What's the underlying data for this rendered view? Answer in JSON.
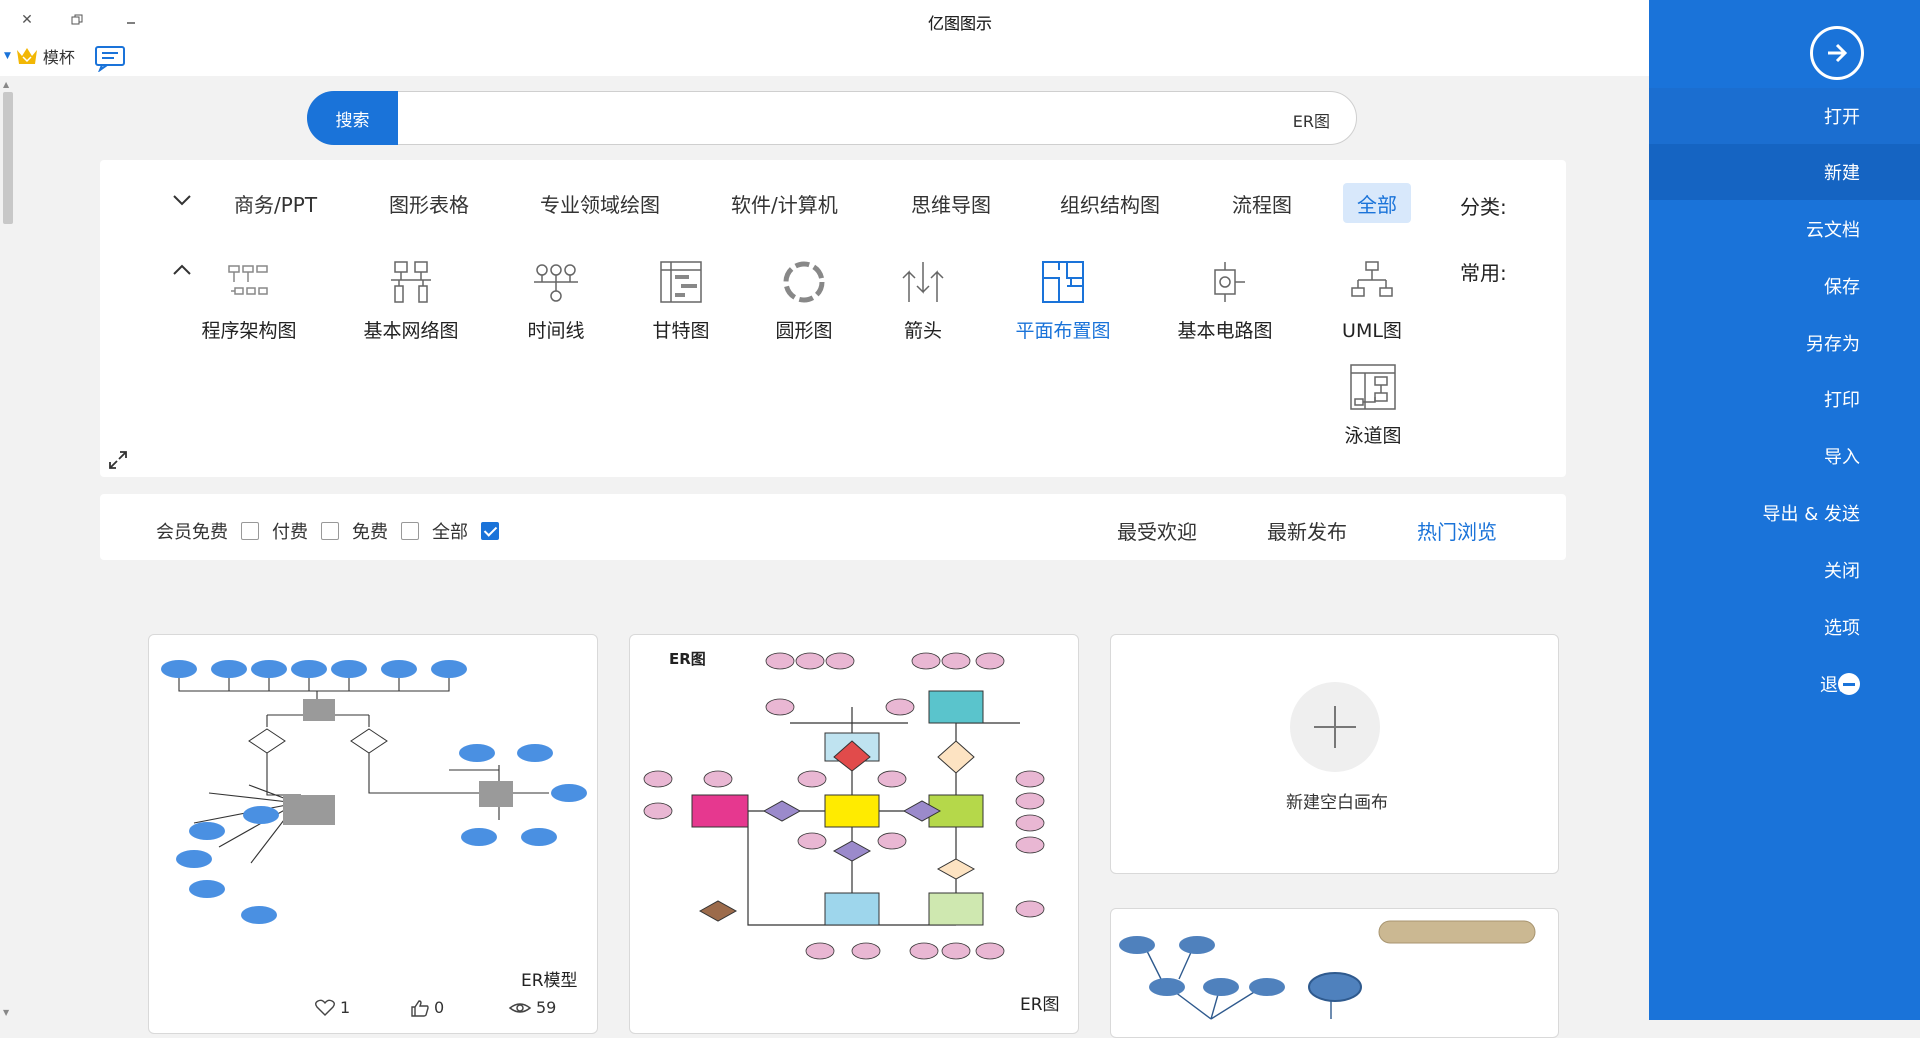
{
  "window": {
    "title": "亿图图示"
  },
  "topbar": {
    "vip_label": "模杯"
  },
  "sidebar": {
    "items": [
      {
        "label": "打开"
      },
      {
        "label": "新建"
      },
      {
        "label": "云文档"
      },
      {
        "label": "保存"
      },
      {
        "label": "另存为"
      },
      {
        "label": "打印"
      },
      {
        "label": "导入"
      },
      {
        "label": "导出 & 发送"
      },
      {
        "label": "关闭"
      },
      {
        "label": "选项"
      },
      {
        "label": "退出"
      }
    ],
    "active": "新建"
  },
  "search": {
    "button_label": "搜索",
    "value": "ER图"
  },
  "categories": {
    "label": "分类:",
    "tabs": [
      "全部",
      "流程图",
      "组织结构图",
      "思维导图",
      "软件/计算机",
      "专业领域绘图",
      "图形表格",
      "商务/PPT"
    ],
    "active": "全部"
  },
  "common": {
    "label": "常用:",
    "items": [
      {
        "label": "UML图",
        "icon": "uml-icon"
      },
      {
        "label": "基本电路图",
        "icon": "circuit-icon"
      },
      {
        "label": "平面布置图",
        "icon": "floorplan-icon"
      },
      {
        "label": "箭头",
        "icon": "arrow-icon"
      },
      {
        "label": "圆形图",
        "icon": "circular-icon"
      },
      {
        "label": "甘特图",
        "icon": "gantt-icon"
      },
      {
        "label": "时间线",
        "icon": "timeline-icon"
      },
      {
        "label": "基本网络图",
        "icon": "network-icon"
      },
      {
        "label": "程序架构图",
        "icon": "architecture-icon"
      },
      {
        "label": "泳道图",
        "icon": "swimlane-icon"
      }
    ],
    "active": "平面布置图"
  },
  "filters": {
    "sort_tabs": [
      "热门浏览",
      "最新发布",
      "最受欢迎"
    ],
    "active_sort": "热门浏览",
    "price": [
      {
        "label": "全部",
        "checked": true
      },
      {
        "label": "免费",
        "checked": false
      },
      {
        "label": "付费",
        "checked": false
      },
      {
        "label": "会员免费",
        "checked": false
      }
    ]
  },
  "cards": {
    "new_canvas_label": "新建空白画布",
    "er_chart": {
      "title": "ER图",
      "inner_title": "ER图"
    },
    "er_model": {
      "title": "ER模型",
      "views": "59",
      "likes": "0",
      "favorites": "1"
    }
  },
  "colors": {
    "accent": "#1a73d9"
  }
}
